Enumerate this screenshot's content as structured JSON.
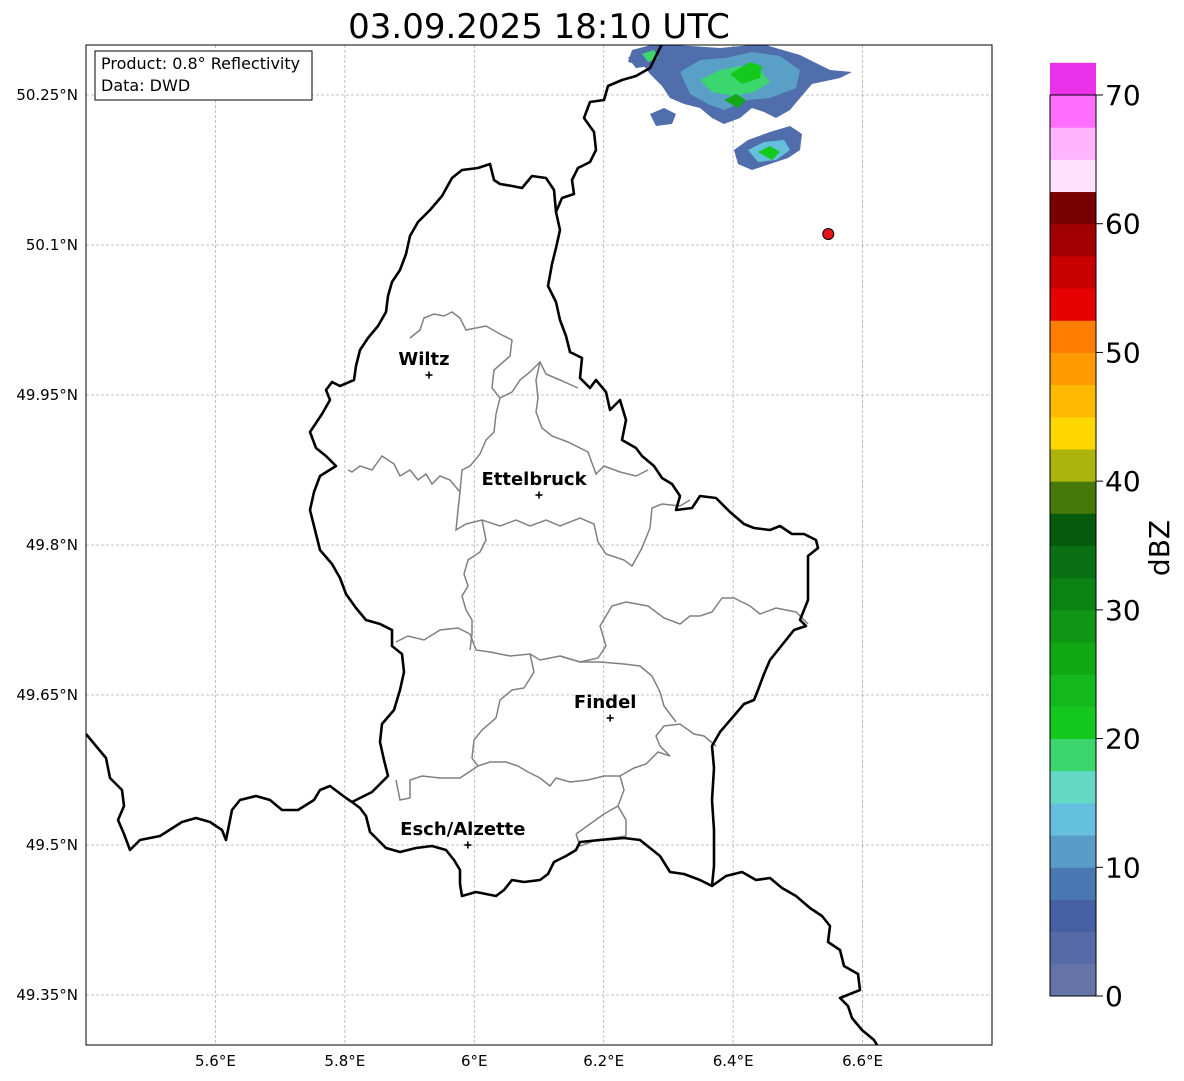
{
  "title": "03.09.2025 18:10 UTC",
  "info_box": {
    "product": "Product: 0.8° Reflectivity",
    "data": "Data: DWD"
  },
  "map": {
    "lon_range": [
      5.4,
      6.8
    ],
    "lat_range": [
      49.3,
      50.3
    ],
    "x_ticks": [
      {
        "lon": 5.6,
        "label": "5.6°E"
      },
      {
        "lon": 5.8,
        "label": "5.8°E"
      },
      {
        "lon": 6.0,
        "label": "6°E"
      },
      {
        "lon": 6.2,
        "label": "6.2°E"
      },
      {
        "lon": 6.4,
        "label": "6.4°E"
      },
      {
        "lon": 6.6,
        "label": "6.6°E"
      }
    ],
    "y_ticks": [
      {
        "lat": 50.25,
        "label": "50.25°N"
      },
      {
        "lat": 50.1,
        "label": "50.1°N"
      },
      {
        "lat": 49.95,
        "label": "49.95°N"
      },
      {
        "lat": 49.8,
        "label": "49.8°N"
      },
      {
        "lat": 49.65,
        "label": "49.65°N"
      },
      {
        "lat": 49.5,
        "label": "49.5°N"
      },
      {
        "lat": 49.35,
        "label": "49.35°N"
      }
    ],
    "grid": true,
    "cities": [
      {
        "name": "Wiltz",
        "lon": 5.93,
        "lat": 49.97
      },
      {
        "name": "Ettelbruck",
        "lon": 6.1,
        "lat": 49.85
      },
      {
        "name": "Findel",
        "lon": 6.21,
        "lat": 49.627
      },
      {
        "name": "Esch/Alzette",
        "lon": 5.99,
        "lat": 49.5
      }
    ],
    "marker": {
      "lon": 6.547,
      "lat": 50.111,
      "color": "#e8141b"
    }
  },
  "colorbar": {
    "label": "dBZ",
    "min": 0,
    "max": 70,
    "step": 2.5,
    "tick_values": [
      0,
      10,
      20,
      30,
      40,
      50,
      60,
      70
    ],
    "tick_labels": [
      "0",
      "10",
      "20",
      "30",
      "40",
      "50",
      "60",
      "70"
    ],
    "colors": [
      "#6473a8",
      "#556aa6",
      "#4660a4",
      "#4a78b2",
      "#5a9cc8",
      "#64c0dc",
      "#64d8c4",
      "#3cd66e",
      "#14c81e",
      "#14b91e",
      "#11a814",
      "#0f9614",
      "#0d8214",
      "#0a7014",
      "#065a0e",
      "#46780a",
      "#aab40a",
      "#ffd700",
      "#ffb900",
      "#ff9b00",
      "#ff7d00",
      "#e60000",
      "#c80000",
      "#a00000",
      "#780000",
      "#ffe1ff",
      "#ffb4ff",
      "#ff6eff",
      "#eb32eb"
    ]
  },
  "chart_data": {
    "type": "heatmap",
    "title": "03.09.2025 18:10 UTC",
    "xlabel": "",
    "ylabel": "",
    "xlim": [
      5.4,
      6.8
    ],
    "ylim": [
      49.3,
      50.3
    ],
    "colorbar_label": "dBZ",
    "colorbar_range": [
      0,
      70
    ],
    "echo_cells": [
      {
        "lon": 6.28,
        "lat": 50.295,
        "dbz": 17
      },
      {
        "lon": 6.36,
        "lat": 50.28,
        "dbz": 20
      },
      {
        "lon": 6.42,
        "lat": 50.27,
        "dbz": 22
      },
      {
        "lon": 6.46,
        "lat": 50.29,
        "dbz": 21
      },
      {
        "lon": 6.4,
        "lat": 50.245,
        "dbz": 28
      },
      {
        "lon": 6.33,
        "lat": 50.24,
        "dbz": 12
      },
      {
        "lon": 6.27,
        "lat": 50.23,
        "dbz": 8
      },
      {
        "lon": 6.45,
        "lat": 50.16,
        "dbz": 24
      },
      {
        "lon": 6.49,
        "lat": 50.18,
        "dbz": 14
      }
    ]
  }
}
